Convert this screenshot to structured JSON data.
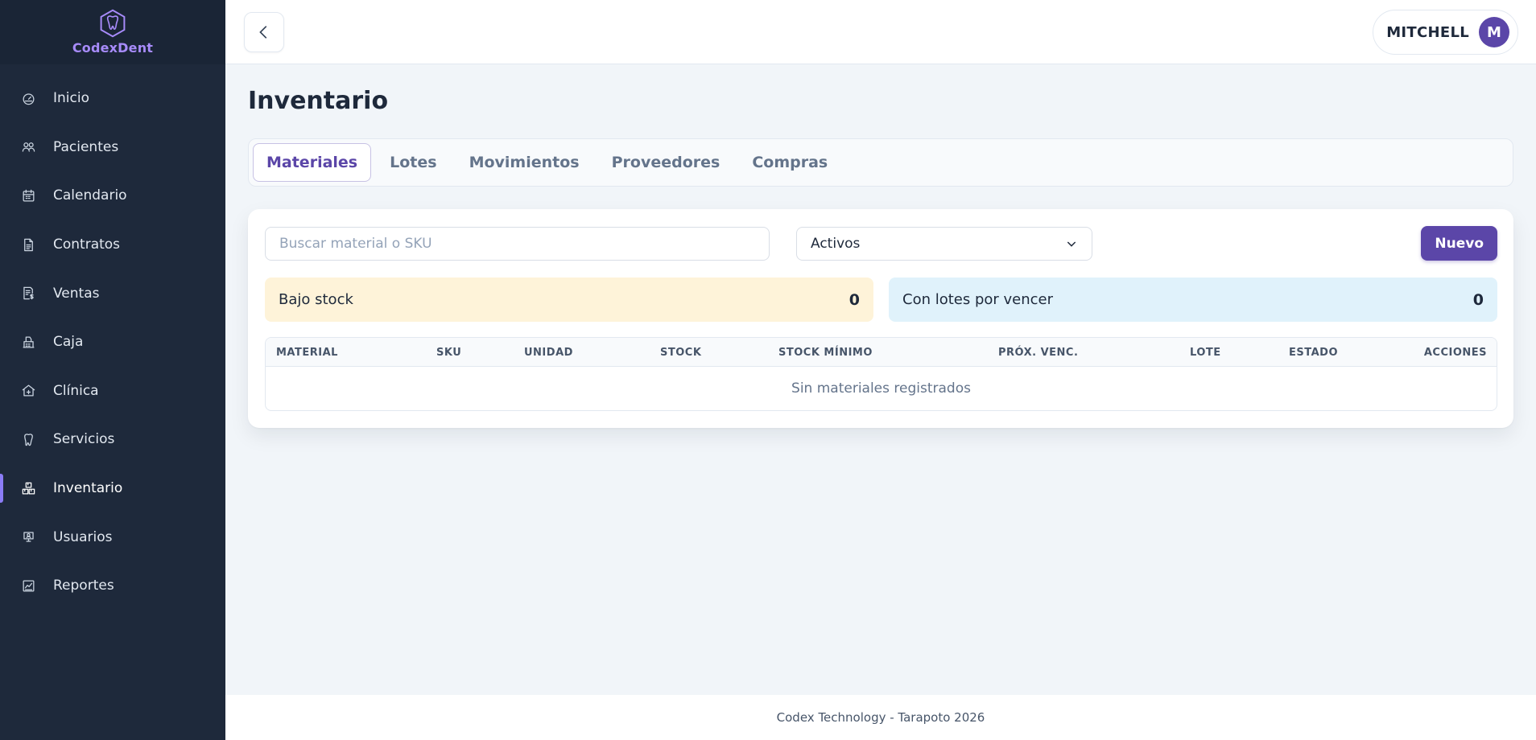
{
  "brand": {
    "name": "CodexDent",
    "logo_icon": "tooth-icon",
    "accent_color": "#a78bfa"
  },
  "sidebar": {
    "items": [
      {
        "label": "Inicio",
        "icon": "dashboard-icon"
      },
      {
        "label": "Pacientes",
        "icon": "users-icon"
      },
      {
        "label": "Calendario",
        "icon": "calendar-icon"
      },
      {
        "label": "Contratos",
        "icon": "document-icon"
      },
      {
        "label": "Ventas",
        "icon": "receipt-icon"
      },
      {
        "label": "Caja",
        "icon": "cash-register-icon"
      },
      {
        "label": "Clínica",
        "icon": "clinic-icon"
      },
      {
        "label": "Servicios",
        "icon": "tooth-icon"
      },
      {
        "label": "Inventario",
        "icon": "boxes-icon",
        "active": true
      },
      {
        "label": "Usuarios",
        "icon": "user-badge-icon"
      },
      {
        "label": "Reportes",
        "icon": "chart-icon"
      }
    ]
  },
  "topbar": {
    "back_icon": "chevron-left-icon",
    "user": {
      "name": "MITCHELL",
      "initial": "M",
      "avatar_color": "#5b46a8"
    }
  },
  "page": {
    "title": "Inventario"
  },
  "tabs": [
    {
      "label": "Materiales",
      "active": true
    },
    {
      "label": "Lotes"
    },
    {
      "label": "Movimientos"
    },
    {
      "label": "Proveedores"
    },
    {
      "label": "Compras"
    }
  ],
  "filters": {
    "search_placeholder": "Buscar material o SKU",
    "search_value": "",
    "status_selected": "Activos",
    "new_button_label": "Nuevo"
  },
  "stats": {
    "low_stock": {
      "label": "Bajo stock",
      "value": "0",
      "color": "#fef3d9"
    },
    "expiring": {
      "label": "Con lotes por vencer",
      "value": "0",
      "color": "#e0f2fb"
    }
  },
  "table": {
    "columns": [
      "MATERIAL",
      "SKU",
      "UNIDAD",
      "STOCK",
      "STOCK MÍNIMO",
      "PRÓX. VENC.",
      "LOTE",
      "ESTADO",
      "ACCIONES"
    ],
    "rows": [],
    "empty_message": "Sin materiales registrados"
  },
  "footer": {
    "text": "Codex Technology - Tarapoto 2026"
  }
}
